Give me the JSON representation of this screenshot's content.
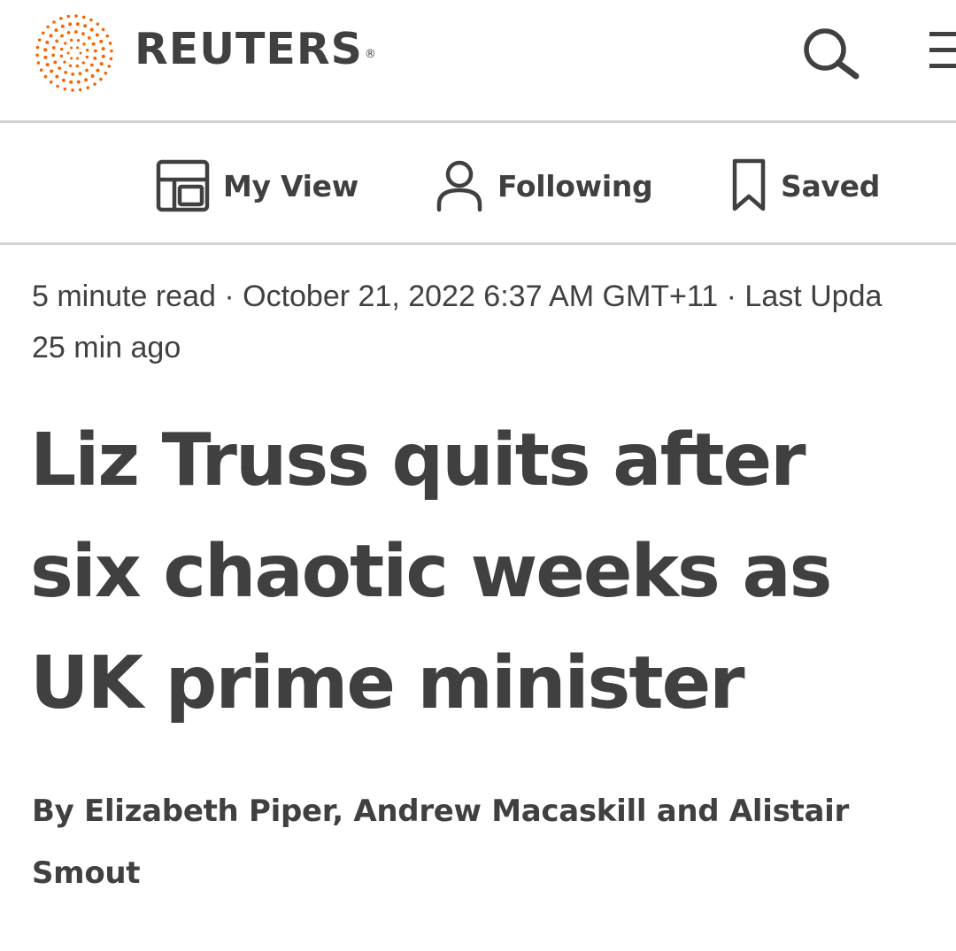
{
  "header": {
    "brand": "REUTERS",
    "registered_mark": "®",
    "brand_color": "#fa6400",
    "search_icon": "search-icon",
    "menu_icon": "hamburger-menu-icon"
  },
  "nav": {
    "items": [
      {
        "label": "My View",
        "icon": "layout-grid-icon"
      },
      {
        "label": "Following",
        "icon": "person-icon"
      },
      {
        "label": "Saved",
        "icon": "bookmark-icon"
      }
    ]
  },
  "article": {
    "meta": {
      "read_time": "5 minute read",
      "separator": " · ",
      "published": "October 21, 2022 6:37 AM GMT+11",
      "updated_prefix": "Last Upda",
      "updated_line2": "25 min ago"
    },
    "headline_lines": [
      "Liz Truss quits after",
      "six chaotic weeks as",
      "UK prime minister"
    ],
    "byline_lines": [
      "By Elizabeth Piper, Andrew Macaskill and Alistair",
      "Smout"
    ]
  },
  "colors": {
    "text": "#404040",
    "divider": "#d3d3d3",
    "accent": "#fa6400"
  }
}
